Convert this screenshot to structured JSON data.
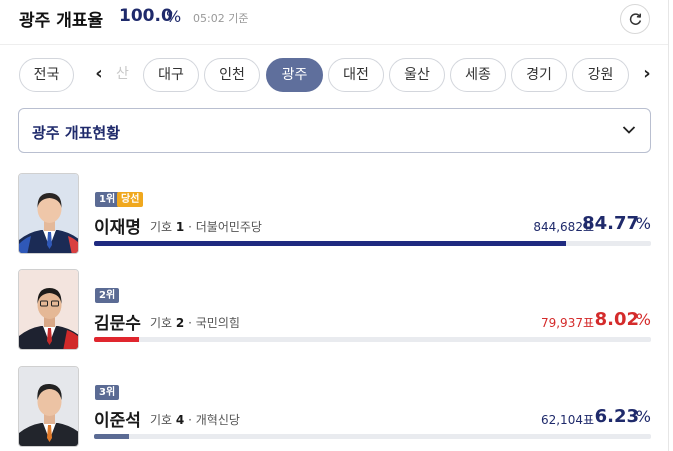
{
  "header": {
    "title": "광주 개표율",
    "rate": "100.0",
    "rate_unit": "%",
    "time": "05:02 기준"
  },
  "tabs": {
    "all": "전국",
    "faded": "산",
    "items": [
      "대구",
      "인천",
      "광주",
      "대전",
      "울산",
      "세종",
      "경기",
      "강원"
    ],
    "active": "광주",
    "prev_arrow": "‹",
    "next_arrow": "›"
  },
  "select": {
    "label": "광주 개표현황"
  },
  "candidates": [
    {
      "rank": "1위",
      "status": "당선",
      "name": "이재명",
      "number_label": "기호",
      "number": "1",
      "party": "더불어민주당",
      "votes": "844,682표",
      "percent": "84.77",
      "percent_unit": "%",
      "share": 0.8477,
      "color": "#1f2a80"
    },
    {
      "rank": "2위",
      "name": "김문수",
      "number_label": "기호",
      "number": "2",
      "party": "국민의힘",
      "votes": "79,937표",
      "percent": "8.02",
      "percent_unit": "%",
      "share": 0.0802,
      "color": "#e0262e"
    },
    {
      "rank": "3위",
      "name": "이준석",
      "number_label": "기호",
      "number": "4",
      "party": "개혁신당",
      "votes": "62,104표",
      "percent": "6.23",
      "percent_unit": "%",
      "share": 0.0623,
      "color": "#5b6b94"
    }
  ]
}
